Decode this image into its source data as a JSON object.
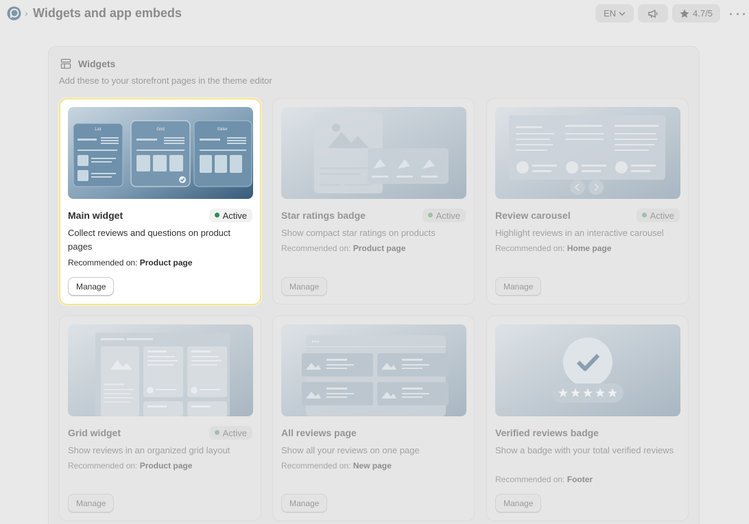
{
  "header": {
    "page_title": "Widgets and app embeds",
    "language": "EN",
    "rating": "4.7/5"
  },
  "section": {
    "title": "Widgets",
    "subtitle": "Add these to your storefront pages in the theme editor"
  },
  "recommended_prefix": "Recommended on:",
  "manage_label": "Manage",
  "widgets": [
    {
      "name": "Main widget",
      "badge": "Active",
      "description": "Collect reviews and questions on product pages",
      "recommended_page": "Product page",
      "thumb_labels": [
        "List",
        "Grid",
        "Slider"
      ]
    },
    {
      "name": "Star ratings badge",
      "badge": "Active",
      "description": "Show compact star ratings on products",
      "recommended_page": "Product page"
    },
    {
      "name": "Review carousel",
      "badge": "Active",
      "description": "Highlight reviews in an interactive carousel",
      "recommended_page": "Home page"
    },
    {
      "name": "Grid widget",
      "badge": "Active",
      "description": "Show reviews in an organized grid layout",
      "recommended_page": "Product page"
    },
    {
      "name": "All reviews page",
      "description": "Show all your reviews on one page",
      "recommended_page": "New page"
    },
    {
      "name": "Verified reviews badge",
      "description": "Show a badge with your total verified reviews",
      "recommended_page": "Footer"
    }
  ],
  "icons": {
    "logo": "app-logo-icon",
    "breadcrumb": "chevron-right-icon",
    "language": "chevron-down-icon",
    "announce": "megaphone-icon",
    "rating": "star-icon",
    "more": "more-horizontal-icon",
    "section": "layout-icon"
  },
  "colors": {
    "active_dot": "#2e8b57",
    "highlight_border": "#f2e39a"
  }
}
